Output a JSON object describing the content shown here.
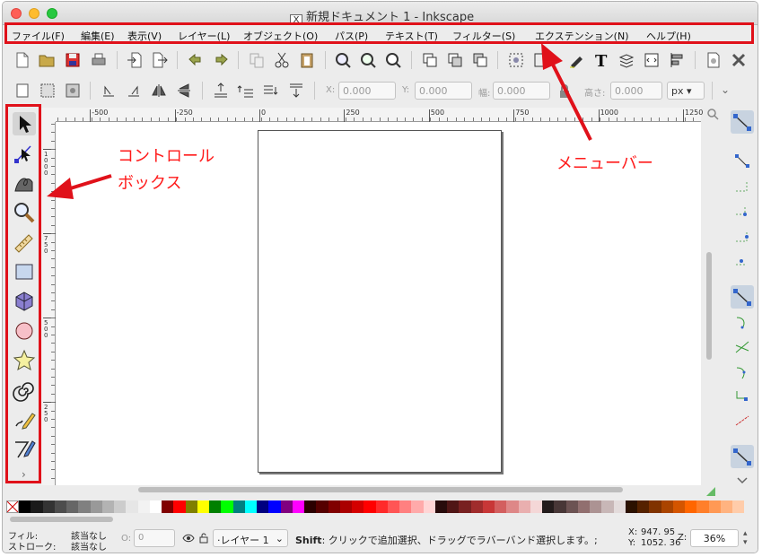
{
  "window": {
    "title": "新規ドキュメント 1 - Inkscape",
    "app_icon": "X"
  },
  "menu": [
    "ファイル(F)",
    "編集(E)",
    "表示(V)",
    "レイヤー(L)",
    "オブジェクト(O)",
    "パス(P)",
    "テキスト(T)",
    "フィルター(S)",
    "エクステンション(N)",
    "ヘルプ(H)"
  ],
  "toolbar2": {
    "x_label": "X:",
    "x_value": "0.000",
    "y_label": "Y:",
    "y_value": "0.000",
    "w_label": "幅:",
    "w_value": "0.000",
    "h_label": "高さ:",
    "h_value": "0.000",
    "unit": "px"
  },
  "ruler_h_labels": [
    "-500",
    "-250",
    "0",
    "250",
    "500",
    "750",
    "1000",
    "1250"
  ],
  "ruler_v_labels": [
    "1000",
    "750",
    "500",
    "250"
  ],
  "tools": [
    "selector-icon",
    "node-icon",
    "tweak-icon",
    "zoom-icon",
    "measure-icon",
    "rectangle-icon",
    "3dbox-icon",
    "ellipse-icon",
    "star-icon",
    "spiral-icon",
    "pencil-icon",
    "pen-icon"
  ],
  "toolbox_more": "›",
  "annotations": {
    "control_box_line1": "コントロール",
    "control_box_line2": "ボックス",
    "menubar": "メニューバー"
  },
  "status": {
    "fill_label": "フィル:",
    "fill_value": "該当なし",
    "stroke_label": "ストローク:",
    "stroke_value": "該当なし",
    "opacity_label": "O:",
    "opacity_value": "0",
    "layer": "·レイヤー 1",
    "message_key": "Shift",
    "message": ": クリックで追加選択、ドラッグでラバーバンド選択します。;",
    "x_label": "X:",
    "x_value": "947. 95",
    "y_label": "Y:",
    "y_value": "1052. 36",
    "z_label": "Z:",
    "zoom": "36%"
  },
  "colors": {
    "accent_red": "#e0111a",
    "swatches": [
      "#000000",
      "#1a1a1a",
      "#333333",
      "#4d4d4d",
      "#666666",
      "#808080",
      "#999999",
      "#b3b3b3",
      "#cccccc",
      "#e6e6e6",
      "#f2f2f2",
      "#ffffff",
      "#800000",
      "#ff0000",
      "#808000",
      "#ffff00",
      "#008000",
      "#00ff00",
      "#008080",
      "#00ffff",
      "#000080",
      "#0000ff",
      "#800080",
      "#ff00ff",
      "#2b0000",
      "#550000",
      "#800000",
      "#aa0000",
      "#d40000",
      "#ff0000",
      "#ff2a2a",
      "#ff5555",
      "#ff8080",
      "#ffaaaa",
      "#ffd5d5",
      "#280b0b",
      "#501616",
      "#782121",
      "#a02c2c",
      "#c83737",
      "#d35f5f",
      "#de8787",
      "#e9afaf",
      "#f4d7d7",
      "#241c1c",
      "#483737",
      "#6c5353",
      "#916f6f",
      "#ac9393",
      "#c8b7b7",
      "#e3dbdb",
      "#2b1100",
      "#552200",
      "#803300",
      "#aa4400",
      "#d45500",
      "#ff6600",
      "#ff7f2a",
      "#ff9955",
      "#ffb380",
      "#ffccaa"
    ]
  }
}
